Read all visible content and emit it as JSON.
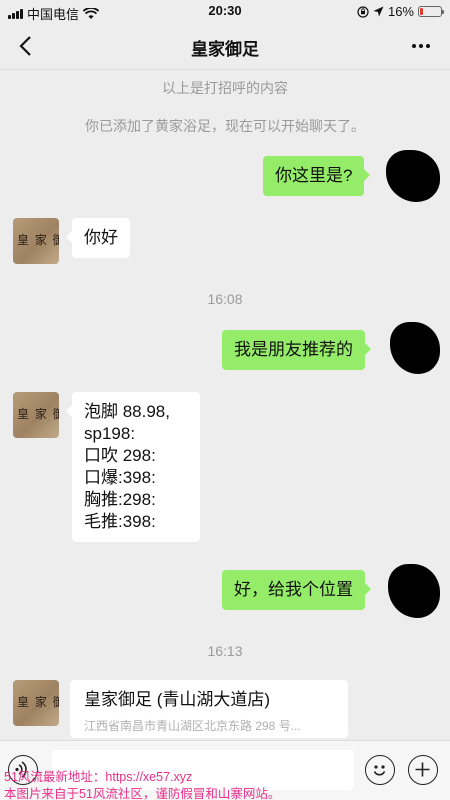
{
  "status_bar": {
    "carrier": "中国电信",
    "time": "20:30",
    "battery": "16%",
    "battery_level": 0.16,
    "battery_color": "#e23b2e"
  },
  "nav": {
    "title": "皇家御足"
  },
  "system_notes": {
    "greeting_note": "以上是打招呼的内容",
    "added_note": "你已添加了黄家浴足，现在可以开始聊天了。",
    "time_1": "16:08",
    "time_2": "16:13"
  },
  "messages": {
    "m1": "你这里是?",
    "m2": "你好",
    "m3": "我是朋友推荐的",
    "m4_lines": [
      "泡脚 88.98,",
      "sp198:",
      "口吹 298:",
      "口爆:398:",
      "胸推:298:",
      "毛推:398:"
    ],
    "m5": "好，给我个位置"
  },
  "avatar_text": "皇 家 御 足",
  "location": {
    "name": "皇家御足 (青山湖大道店)",
    "address": "江西省南昌市青山湖区北京东路 298 号..."
  },
  "watermark": {
    "line1": "51风流最新地址：https://xe57.xyz",
    "line2": "本图片来自于51风流社区，谨防假冒和山寨网站。"
  },
  "colors": {
    "bubble_sent": "#95ec69",
    "bubble_received": "#ffffff",
    "background": "#ededed",
    "watermark": "#e8308a"
  },
  "icons": [
    "signal-icon",
    "wifi-icon",
    "lock-rotation-icon",
    "location-arrow-icon",
    "battery-icon",
    "back-chevron-icon",
    "more-icon",
    "voice-icon",
    "emoji-icon",
    "plus-icon"
  ]
}
